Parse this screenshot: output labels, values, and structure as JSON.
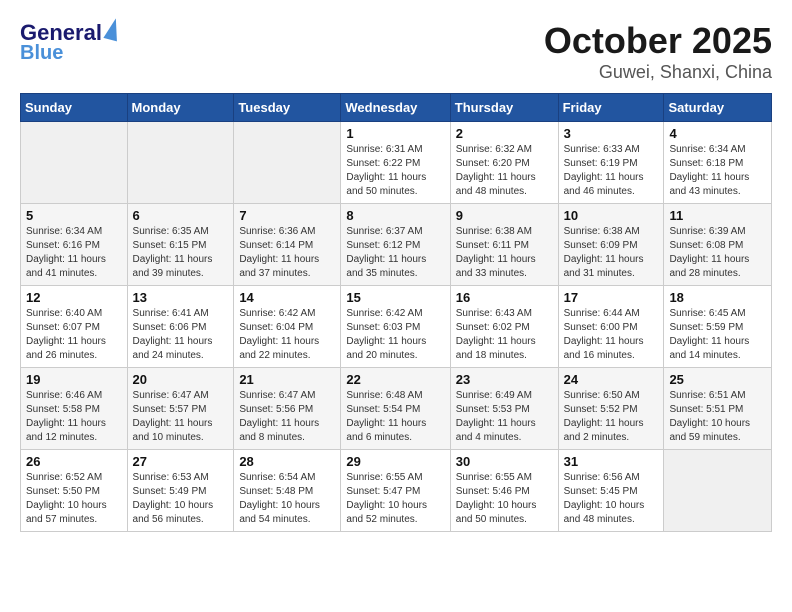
{
  "header": {
    "logo_general": "General",
    "logo_blue": "Blue",
    "month_title": "October 2025",
    "location": "Guwei, Shanxi, China"
  },
  "weekdays": [
    "Sunday",
    "Monday",
    "Tuesday",
    "Wednesday",
    "Thursday",
    "Friday",
    "Saturday"
  ],
  "weeks": [
    [
      {
        "day": "",
        "info": ""
      },
      {
        "day": "",
        "info": ""
      },
      {
        "day": "",
        "info": ""
      },
      {
        "day": "1",
        "info": "Sunrise: 6:31 AM\nSunset: 6:22 PM\nDaylight: 11 hours and 50 minutes."
      },
      {
        "day": "2",
        "info": "Sunrise: 6:32 AM\nSunset: 6:20 PM\nDaylight: 11 hours and 48 minutes."
      },
      {
        "day": "3",
        "info": "Sunrise: 6:33 AM\nSunset: 6:19 PM\nDaylight: 11 hours and 46 minutes."
      },
      {
        "day": "4",
        "info": "Sunrise: 6:34 AM\nSunset: 6:18 PM\nDaylight: 11 hours and 43 minutes."
      }
    ],
    [
      {
        "day": "5",
        "info": "Sunrise: 6:34 AM\nSunset: 6:16 PM\nDaylight: 11 hours and 41 minutes."
      },
      {
        "day": "6",
        "info": "Sunrise: 6:35 AM\nSunset: 6:15 PM\nDaylight: 11 hours and 39 minutes."
      },
      {
        "day": "7",
        "info": "Sunrise: 6:36 AM\nSunset: 6:14 PM\nDaylight: 11 hours and 37 minutes."
      },
      {
        "day": "8",
        "info": "Sunrise: 6:37 AM\nSunset: 6:12 PM\nDaylight: 11 hours and 35 minutes."
      },
      {
        "day": "9",
        "info": "Sunrise: 6:38 AM\nSunset: 6:11 PM\nDaylight: 11 hours and 33 minutes."
      },
      {
        "day": "10",
        "info": "Sunrise: 6:38 AM\nSunset: 6:09 PM\nDaylight: 11 hours and 31 minutes."
      },
      {
        "day": "11",
        "info": "Sunrise: 6:39 AM\nSunset: 6:08 PM\nDaylight: 11 hours and 28 minutes."
      }
    ],
    [
      {
        "day": "12",
        "info": "Sunrise: 6:40 AM\nSunset: 6:07 PM\nDaylight: 11 hours and 26 minutes."
      },
      {
        "day": "13",
        "info": "Sunrise: 6:41 AM\nSunset: 6:06 PM\nDaylight: 11 hours and 24 minutes."
      },
      {
        "day": "14",
        "info": "Sunrise: 6:42 AM\nSunset: 6:04 PM\nDaylight: 11 hours and 22 minutes."
      },
      {
        "day": "15",
        "info": "Sunrise: 6:42 AM\nSunset: 6:03 PM\nDaylight: 11 hours and 20 minutes."
      },
      {
        "day": "16",
        "info": "Sunrise: 6:43 AM\nSunset: 6:02 PM\nDaylight: 11 hours and 18 minutes."
      },
      {
        "day": "17",
        "info": "Sunrise: 6:44 AM\nSunset: 6:00 PM\nDaylight: 11 hours and 16 minutes."
      },
      {
        "day": "18",
        "info": "Sunrise: 6:45 AM\nSunset: 5:59 PM\nDaylight: 11 hours and 14 minutes."
      }
    ],
    [
      {
        "day": "19",
        "info": "Sunrise: 6:46 AM\nSunset: 5:58 PM\nDaylight: 11 hours and 12 minutes."
      },
      {
        "day": "20",
        "info": "Sunrise: 6:47 AM\nSunset: 5:57 PM\nDaylight: 11 hours and 10 minutes."
      },
      {
        "day": "21",
        "info": "Sunrise: 6:47 AM\nSunset: 5:56 PM\nDaylight: 11 hours and 8 minutes."
      },
      {
        "day": "22",
        "info": "Sunrise: 6:48 AM\nSunset: 5:54 PM\nDaylight: 11 hours and 6 minutes."
      },
      {
        "day": "23",
        "info": "Sunrise: 6:49 AM\nSunset: 5:53 PM\nDaylight: 11 hours and 4 minutes."
      },
      {
        "day": "24",
        "info": "Sunrise: 6:50 AM\nSunset: 5:52 PM\nDaylight: 11 hours and 2 minutes."
      },
      {
        "day": "25",
        "info": "Sunrise: 6:51 AM\nSunset: 5:51 PM\nDaylight: 10 hours and 59 minutes."
      }
    ],
    [
      {
        "day": "26",
        "info": "Sunrise: 6:52 AM\nSunset: 5:50 PM\nDaylight: 10 hours and 57 minutes."
      },
      {
        "day": "27",
        "info": "Sunrise: 6:53 AM\nSunset: 5:49 PM\nDaylight: 10 hours and 56 minutes."
      },
      {
        "day": "28",
        "info": "Sunrise: 6:54 AM\nSunset: 5:48 PM\nDaylight: 10 hours and 54 minutes."
      },
      {
        "day": "29",
        "info": "Sunrise: 6:55 AM\nSunset: 5:47 PM\nDaylight: 10 hours and 52 minutes."
      },
      {
        "day": "30",
        "info": "Sunrise: 6:55 AM\nSunset: 5:46 PM\nDaylight: 10 hours and 50 minutes."
      },
      {
        "day": "31",
        "info": "Sunrise: 6:56 AM\nSunset: 5:45 PM\nDaylight: 10 hours and 48 minutes."
      },
      {
        "day": "",
        "info": ""
      }
    ]
  ]
}
